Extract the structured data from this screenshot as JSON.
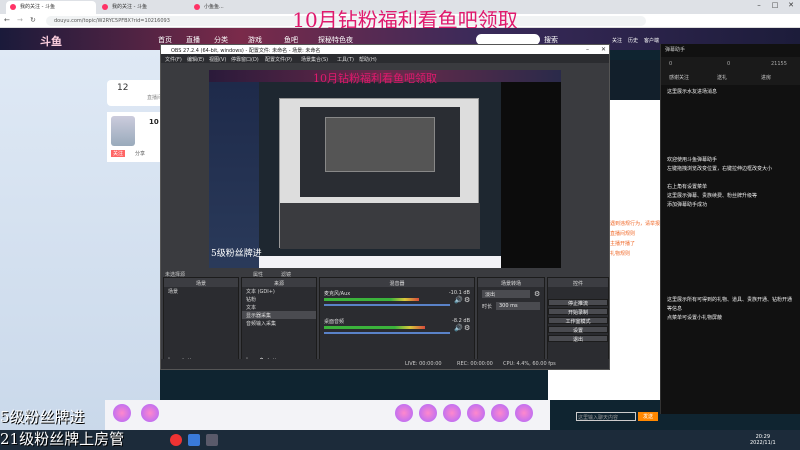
{
  "browser": {
    "tabs": [
      "我的关注 - 斗鱼",
      "我的关注 - 斗鱼",
      "小鱼鱼..."
    ],
    "url": "douyu.com/topic/W2RYC5PFBX?rid=10216093",
    "overlay_title": "10月钻粉福利看鱼吧领取"
  },
  "douyu": {
    "logo": "斗鱼",
    "nav": [
      "首页",
      "直播",
      "分类",
      "游戏",
      "鱼吧",
      "探秘特色夜"
    ],
    "search_btn": "搜索",
    "nav_right": [
      "关注",
      "历史",
      "客户端",
      "创作中心",
      "消息"
    ],
    "fans_count": "12",
    "fans_label": "直播间",
    "side_item": "10",
    "btn_follow": "关注",
    "btn_share": "分享",
    "orange_texts": [
      "遇到违规行为，请举报",
      "直播间规则",
      "主播开播了",
      "礼物规则"
    ],
    "chat_input_placeholder": "这里输入聊天内容",
    "send_btn": "发送"
  },
  "obs": {
    "title": "OBS 27.2.4 (64-bit, windows) - 配置文件: 未命名 - 场景: 未命名",
    "menu": [
      "文件(F)",
      "编辑(E)",
      "视图(V)",
      "停靠窗口(D)",
      "配置文件(P)",
      "场景集合(S)",
      "工具(T)",
      "帮助(H)"
    ],
    "preview_overlay": "10月钻粉福利看鱼吧领取",
    "preview_label": "5级粉丝牌进",
    "no_source_label": "未选择源",
    "properties_label": "属性",
    "filters_label": "滤镜",
    "docks": {
      "scenes": "场景",
      "sources": "来源",
      "mixer": "混音器",
      "transitions": "场景转场",
      "controls": "控件"
    },
    "scenes": [
      "场景"
    ],
    "sources": [
      "文本 (GDI+)",
      "钻粉",
      "文本",
      "显示器采集",
      "音频输入采集"
    ],
    "mixer": [
      {
        "name": "麦克风/Aux",
        "db": "-10.1 dB",
        "level": 0.75
      },
      {
        "name": "桌面音频",
        "db": "-8.2 dB",
        "level": 0.8
      }
    ],
    "transition": {
      "type": "淡出",
      "duration_label": "时长",
      "duration": "300 ms"
    },
    "controls": [
      "停止推流",
      "开始录制",
      "工作室模式",
      "设置",
      "退出"
    ],
    "status": {
      "live": "LIVE: 00:00:00",
      "rec": "REC: 00:00:00",
      "cpu": "CPU: 4.4%, 60.00 fps"
    }
  },
  "chat": {
    "title": "弹幕助手",
    "tabs": [
      "感谢关注",
      "送礼",
      "进房"
    ],
    "counts": [
      "0",
      "0",
      "21155"
    ],
    "messages": [
      "这里展示水友进场消息",
      "欢迎使用斗鱼弹幕助手",
      "左键拖拽浏览改变位置，右键拉伸边框改变大小",
      "右上角有设置菜单",
      "这里展示弹幕、贵族续费、粉丝牌升级等",
      "添加弹幕助手成功",
      "这里展示所有可得到的礼物、道具、贵族开通、钻粉开通等信息",
      "点菜单可设置小礼物屏蔽"
    ]
  },
  "bottom": {
    "line1": "5级粉丝牌进",
    "line2": "21级粉丝牌上房管"
  },
  "taskbar": {
    "time": "20:29",
    "date": "2022/11/1"
  }
}
